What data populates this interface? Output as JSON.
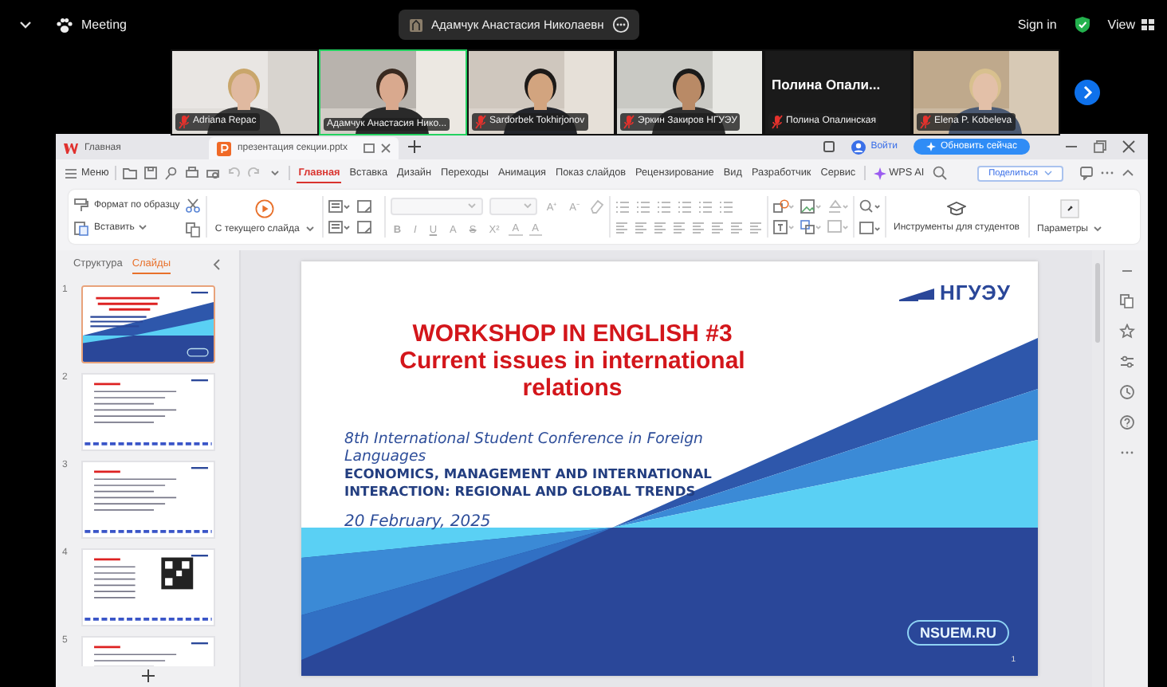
{
  "meeting": {
    "title": "Meeting",
    "speaker": "Адамчук Анастасия Николаевн",
    "sign_in": "Sign in",
    "view": "View"
  },
  "participants": [
    {
      "kind": "video",
      "name": "Adriana Repac",
      "muted": true,
      "selected": false
    },
    {
      "kind": "video",
      "name": "Адамчук Анастасия Нико...",
      "muted": false,
      "selected": true
    },
    {
      "kind": "video",
      "name": "Sardorbek Tokhirjonov",
      "muted": true,
      "selected": false
    },
    {
      "kind": "video",
      "name": "Эркин Закиров НГУЭУ",
      "muted": true,
      "selected": false
    },
    {
      "kind": "name",
      "caption": "Полина Опали...",
      "name": "Полина Опалинская",
      "muted": true,
      "selected": false
    },
    {
      "kind": "video",
      "name": "Elena P. Kobeleva",
      "muted": true,
      "selected": false
    }
  ],
  "editor": {
    "tabs": [
      {
        "kind": "home",
        "label": "Главная",
        "selected": false
      },
      {
        "kind": "document",
        "label": "презентация секции.pptx",
        "selected": true
      }
    ],
    "login": "Войти",
    "update_button": "Обновить сейчас",
    "menu_label": "Меню",
    "ribbon_tabs": [
      {
        "label": "Главная",
        "selected": true
      },
      {
        "label": "Вставка",
        "selected": false
      },
      {
        "label": "Дизайн",
        "selected": false
      },
      {
        "label": "Переходы",
        "selected": false
      },
      {
        "label": "Анимация",
        "selected": false
      },
      {
        "label": "Показ слайдов",
        "selected": false
      },
      {
        "label": "Рецензирование",
        "selected": false
      },
      {
        "label": "Вид",
        "selected": false
      },
      {
        "label": "Разработчик",
        "selected": false
      },
      {
        "label": "Сервис",
        "selected": false
      }
    ],
    "wps_ai": "WPS AI",
    "share_button": "Поделиться",
    "ribbon": {
      "format_painter": "Формат по образцу",
      "paste": "Вставить",
      "from_current": "С текущего слайда",
      "font_size_buttons": [
        "A⁺",
        "A⁻"
      ],
      "format_buttons": [
        "B",
        "I",
        "U",
        "A",
        "S",
        "X²",
        "A",
        "A"
      ],
      "student_tools": "Инструменты для студентов",
      "parameters": "Параметры"
    }
  },
  "panel": {
    "tabs": [
      {
        "label": "Структура",
        "selected": false
      },
      {
        "label": "Слайды",
        "selected": true
      }
    ],
    "thumbnails": [
      {
        "number": "1",
        "kind": "title",
        "selected": true
      },
      {
        "number": "2",
        "kind": "text",
        "selected": false
      },
      {
        "number": "3",
        "kind": "text",
        "selected": false
      },
      {
        "number": "4",
        "kind": "qr",
        "selected": false
      },
      {
        "number": "5",
        "kind": "list",
        "selected": false
      }
    ]
  },
  "slide": {
    "title": "WORKSHOP IN ENGLISH #3",
    "subtitle": "Current issues in international relations",
    "conference": "8th International Student Conference in Foreign Languages",
    "theme": "ECONOMICS, MANAGEMENT AND INTERNATIONAL INTERACTION: REGIONAL AND GLOBAL TRENDS",
    "date": "20 February, 2025",
    "logo": "НГУЭУ",
    "website": "NSUEM.RU",
    "page_number": "1"
  }
}
